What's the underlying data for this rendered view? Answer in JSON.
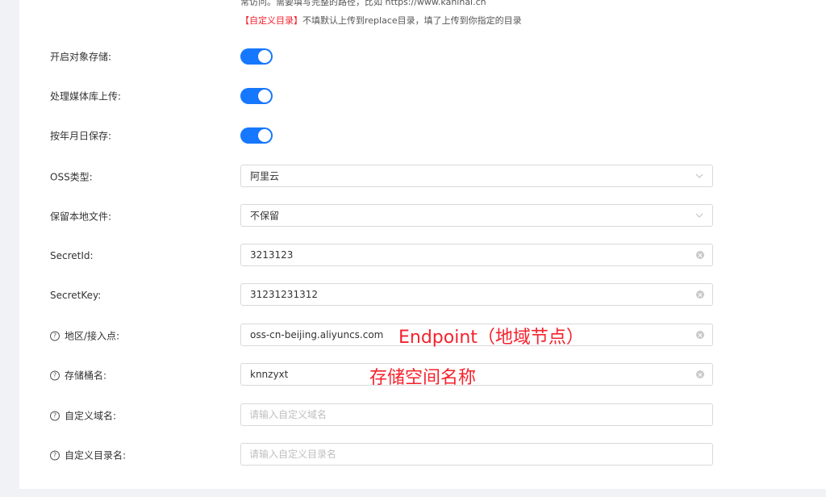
{
  "hints": {
    "line1": "常访问。需要填写完整的路径，比如 https://www.kaninai.cn",
    "line2_red": "【自定义目录】",
    "line2_rest": "不填默认上传到replace目录，填了上传到你指定的目录"
  },
  "form": {
    "enable_storage": {
      "label": "开启对象存储:",
      "on": true
    },
    "media_upload": {
      "label": "处理媒体库上传:",
      "on": true
    },
    "save_by_date": {
      "label": "按年月日保存:",
      "on": true
    },
    "oss_type": {
      "label": "OSS类型:",
      "value": "阿里云"
    },
    "keep_local": {
      "label": "保留本地文件:",
      "value": "不保留"
    },
    "secret_id": {
      "label": "SecretId:",
      "value": "3213123"
    },
    "secret_key": {
      "label": "SecretKey:",
      "value": "31231231312"
    },
    "endpoint": {
      "label": "地区/接入点:",
      "value": "oss-cn-beijing.aliyuncs.com"
    },
    "bucket": {
      "label": "存储桶名:",
      "value": "knnzyxt"
    },
    "custom_domain": {
      "label": "自定义域名:",
      "placeholder": "请输入自定义域名"
    },
    "custom_dir": {
      "label": "自定义目录名:",
      "placeholder": "请输入自定义目录名"
    }
  },
  "annotations": {
    "endpoint_note": "Endpoint（地域节点）",
    "bucket_note": "存储空间名称"
  },
  "colors": {
    "accent": "#1677ff",
    "annotation": "#f5222d",
    "border": "#d9d9d9"
  },
  "icons": {
    "select_arrow": "chevron-down-icon",
    "clear": "clear-circle-icon",
    "help": "question-circle-icon"
  }
}
